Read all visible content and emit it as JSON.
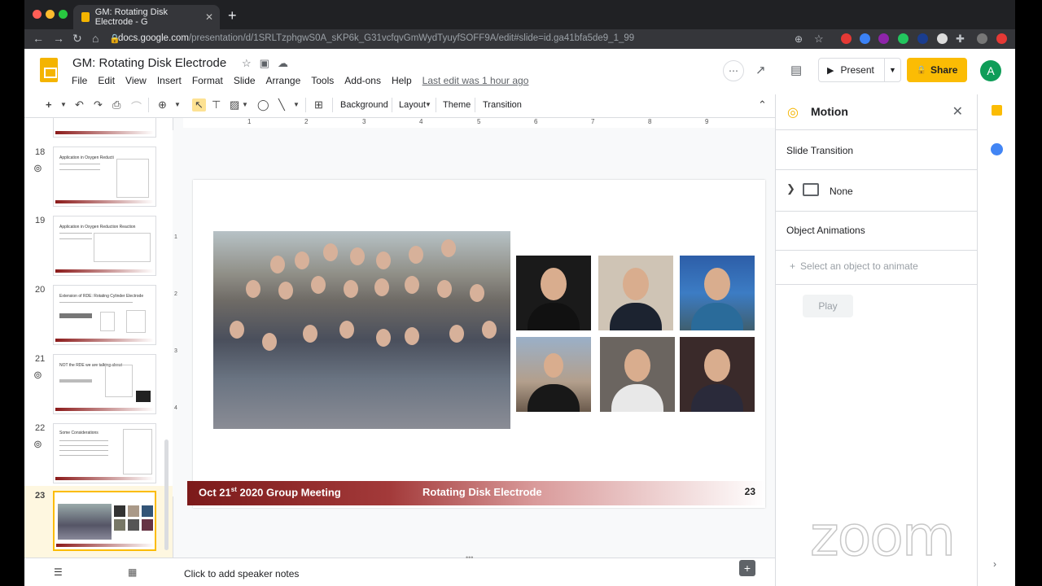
{
  "browser": {
    "tab_title": "GM: Rotating Disk Electrode - G",
    "url_host": "docs.google.com",
    "url_path": "/presentation/d/1SRLTzphgwS0A_sKP6k_G31vcfqvGmWydTyuyfSOFF9A/edit#slide=id.ga41bfa5de9_1_99"
  },
  "doc": {
    "title": "GM: Rotating Disk Electrode",
    "menu": [
      "File",
      "Edit",
      "View",
      "Insert",
      "Format",
      "Slide",
      "Arrange",
      "Tools",
      "Add-ons",
      "Help"
    ],
    "last_edit": "Last edit was 1 hour ago"
  },
  "header_buttons": {
    "present": "Present",
    "share": "Share",
    "avatar": "A"
  },
  "toolbar": {
    "background": "Background",
    "layout": "Layout",
    "theme": "Theme",
    "transition": "Transition"
  },
  "ruler": [
    "1",
    "2",
    "3",
    "4",
    "5",
    "6",
    "7",
    "8",
    "9"
  ],
  "vruler": [
    "1",
    "2",
    "3",
    "4"
  ],
  "slides": [
    {
      "number": "18",
      "title": "Application in Oxygen Reducti"
    },
    {
      "number": "19",
      "title": "Application in Oxygen Reduction Reaction"
    },
    {
      "number": "20",
      "title": "Extension of RDE: Rotating Cylinder Electrode"
    },
    {
      "number": "21",
      "title": "NOT the RDE we are talking about"
    },
    {
      "number": "22",
      "title": "Some Considerations"
    },
    {
      "number": "23",
      "title": ""
    }
  ],
  "slide": {
    "footer_left": "Oct 21",
    "footer_sup": "st",
    "footer_left_rest": " 2020 Group Meeting",
    "footer_center": "Rotating Disk Electrode",
    "footer_number": "23"
  },
  "notes": {
    "placeholder": "Click to add speaker notes"
  },
  "motion_panel": {
    "title": "Motion",
    "slide_transition": "Slide Transition",
    "transition_value": "None",
    "object_animations": "Object Animations",
    "select_object": "Select an object to animate",
    "play": "Play"
  },
  "watermark": "zoom",
  "colors": {
    "accent": "#fbbc04",
    "footer_red": "#7c1a1a"
  }
}
